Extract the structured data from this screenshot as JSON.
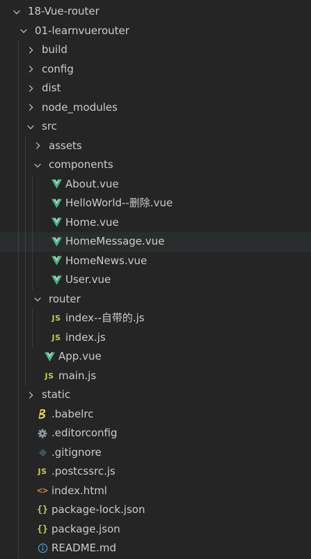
{
  "explorer": {
    "items": [
      {
        "label": "18-Vue-router",
        "type": "folder",
        "expanded": true,
        "depth": 0,
        "icon": "chevron-down-icon"
      },
      {
        "label": "01-learnvuerouter",
        "type": "folder",
        "expanded": true,
        "depth": 1,
        "icon": "chevron-down-icon"
      },
      {
        "label": "build",
        "type": "folder",
        "expanded": false,
        "depth": 2,
        "icon": "chevron-right-icon"
      },
      {
        "label": "config",
        "type": "folder",
        "expanded": false,
        "depth": 2,
        "icon": "chevron-right-icon"
      },
      {
        "label": "dist",
        "type": "folder",
        "expanded": false,
        "depth": 2,
        "icon": "chevron-right-icon"
      },
      {
        "label": "node_modules",
        "type": "folder",
        "expanded": false,
        "depth": 2,
        "icon": "chevron-right-icon"
      },
      {
        "label": "src",
        "type": "folder",
        "expanded": true,
        "depth": 2,
        "icon": "chevron-down-icon"
      },
      {
        "label": "assets",
        "type": "folder",
        "expanded": false,
        "depth": 3,
        "icon": "chevron-right-icon"
      },
      {
        "label": "components",
        "type": "folder",
        "expanded": true,
        "depth": 3,
        "icon": "chevron-down-icon"
      },
      {
        "label": "About.vue",
        "type": "file",
        "depth": 4,
        "icon": "vue-icon"
      },
      {
        "label": "HelloWorld--删除.vue",
        "type": "file",
        "depth": 4,
        "icon": "vue-icon"
      },
      {
        "label": "Home.vue",
        "type": "file",
        "depth": 4,
        "icon": "vue-icon"
      },
      {
        "label": "HomeMessage.vue",
        "type": "file",
        "depth": 4,
        "icon": "vue-icon",
        "hovered": true
      },
      {
        "label": "HomeNews.vue",
        "type": "file",
        "depth": 4,
        "icon": "vue-icon"
      },
      {
        "label": "User.vue",
        "type": "file",
        "depth": 4,
        "icon": "vue-icon"
      },
      {
        "label": "router",
        "type": "folder",
        "expanded": true,
        "depth": 3,
        "icon": "chevron-down-icon"
      },
      {
        "label": "index--自带的.js",
        "type": "file",
        "depth": 4,
        "icon": "js-icon"
      },
      {
        "label": "index.js",
        "type": "file",
        "depth": 4,
        "icon": "js-icon"
      },
      {
        "label": "App.vue",
        "type": "file",
        "depth": 3,
        "icon": "vue-icon"
      },
      {
        "label": "main.js",
        "type": "file",
        "depth": 3,
        "icon": "js-icon"
      },
      {
        "label": "static",
        "type": "folder",
        "expanded": false,
        "depth": 2,
        "icon": "chevron-right-icon"
      },
      {
        "label": ".babelrc",
        "type": "file",
        "depth": 2,
        "icon": "babel-icon"
      },
      {
        "label": ".editorconfig",
        "type": "file",
        "depth": 2,
        "icon": "gear-icon"
      },
      {
        "label": ".gitignore",
        "type": "file",
        "depth": 2,
        "icon": "git-icon"
      },
      {
        "label": ".postcssrc.js",
        "type": "file",
        "depth": 2,
        "icon": "js-icon"
      },
      {
        "label": "index.html",
        "type": "file",
        "depth": 2,
        "icon": "html-icon"
      },
      {
        "label": "package-lock.json",
        "type": "file",
        "depth": 2,
        "icon": "json-icon"
      },
      {
        "label": "package.json",
        "type": "file",
        "depth": 2,
        "icon": "json-icon"
      },
      {
        "label": "README.md",
        "type": "file",
        "depth": 2,
        "icon": "info-icon"
      }
    ]
  },
  "colors": {
    "background": "#252526",
    "hover_row": "#2a2d2e",
    "text": "#cccccc",
    "vue": "#41b883",
    "js": "#cbcb41",
    "html": "#e37933",
    "babel": "#f5da55",
    "info": "#519aba",
    "gear": "#8d9ba3",
    "git": "#41535b"
  }
}
